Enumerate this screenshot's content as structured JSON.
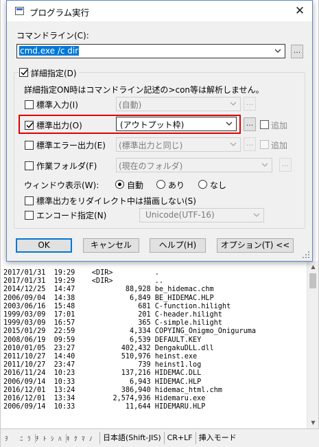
{
  "dialog": {
    "title": "プログラム実行",
    "close_glyph": "✕",
    "command_line_label": "コマンドライン(C):",
    "command_line_value": "cmd.exe /c dir",
    "detail_checkbox_label": "詳細指定(D)",
    "detail_checked": true,
    "note": "詳細指定ON時はコマンドライン記述の>con等は解析しません。",
    "browse_label": "...",
    "stdin": {
      "label": "標準入力(I)",
      "checked": false,
      "value": "(自動)",
      "enabled": false
    },
    "stdout": {
      "label": "標準出力(O)",
      "checked": true,
      "value": "(アウトプット枠)",
      "enabled": true,
      "append_label": "追加"
    },
    "stderr": {
      "label": "標準エラー出力(E)",
      "checked": false,
      "value": "(標準出力と同じ)",
      "enabled": false,
      "append_label": "追加"
    },
    "workdir": {
      "label": "作業フォルダ(F)",
      "checked": false,
      "value": "(現在のフォルダ)",
      "enabled": false
    },
    "window_mode": {
      "label": "ウィンドウ表示(W):",
      "options": [
        "自動",
        "あり",
        "なし"
      ],
      "selected": "自動"
    },
    "no_redraw_label": "標準出力をリダイレクト中は描画しない(S)",
    "encode_label": "エンコード指定(N)",
    "encode_value": "Unicode(UTF-16)",
    "buttons": {
      "ok": "OK",
      "cancel": "キャンセル",
      "help": "ヘルプ(H)",
      "options": "オプション(T) <<"
    },
    "highlight_color": "#e00000"
  },
  "editor": {
    "output_lines": [
      "2017/01/31  19:29    <DIR>          .",
      "2017/01/31  19:29    <DIR>          ..",
      "2014/12/25  14:47            88,928 be_hidemac.chm",
      "2006/09/04  14:38             6,849 BE_HIDEMAC.HLP",
      "2003/06/16  15:48               681 C-function.hilight",
      "1999/03/09  17:01               201 C-header.hilight",
      "1999/03/09  16:57               365 C-simple.hilight",
      "2015/01/29  22:59             4,334 COPYING_Onigmo_Oniguruma",
      "2008/06/19  09:59             6,539 DEFAULT.KEY",
      "2010/01/05  23:27           402,432 DengakuDLL.dll",
      "2011/10/27  14:40           510,976 heinst.exe",
      "2011/10/27  23:47               739 heinst1.log",
      "2016/11/24  10:23           137,216 HIDEMAC.DLL",
      "2006/09/14  10:33             6,943 HIDEMAC.HLP",
      "2016/12/01  13:24           386,940 hidemac_html.chm",
      "2016/12/01  13:34         2,574,936 Hidemaru.exe",
      "2006/09/14  10:33            11,644 HIDEMARU.HLP"
    ],
    "status": {
      "fkeys_left": [
        "ｦ",
        "",
        "ﾆ",
        "ﾗ"
      ],
      "fkeys_right": [
        "ﾁ",
        "ﾄ",
        "ｼ",
        "ﾊ",
        "ｷ",
        "ｸ",
        "ﾏ",
        "ﾉ"
      ],
      "encoding": "日本語(Shift-JIS)",
      "newline": "CR+LF",
      "mode": "挿入モード"
    }
  }
}
